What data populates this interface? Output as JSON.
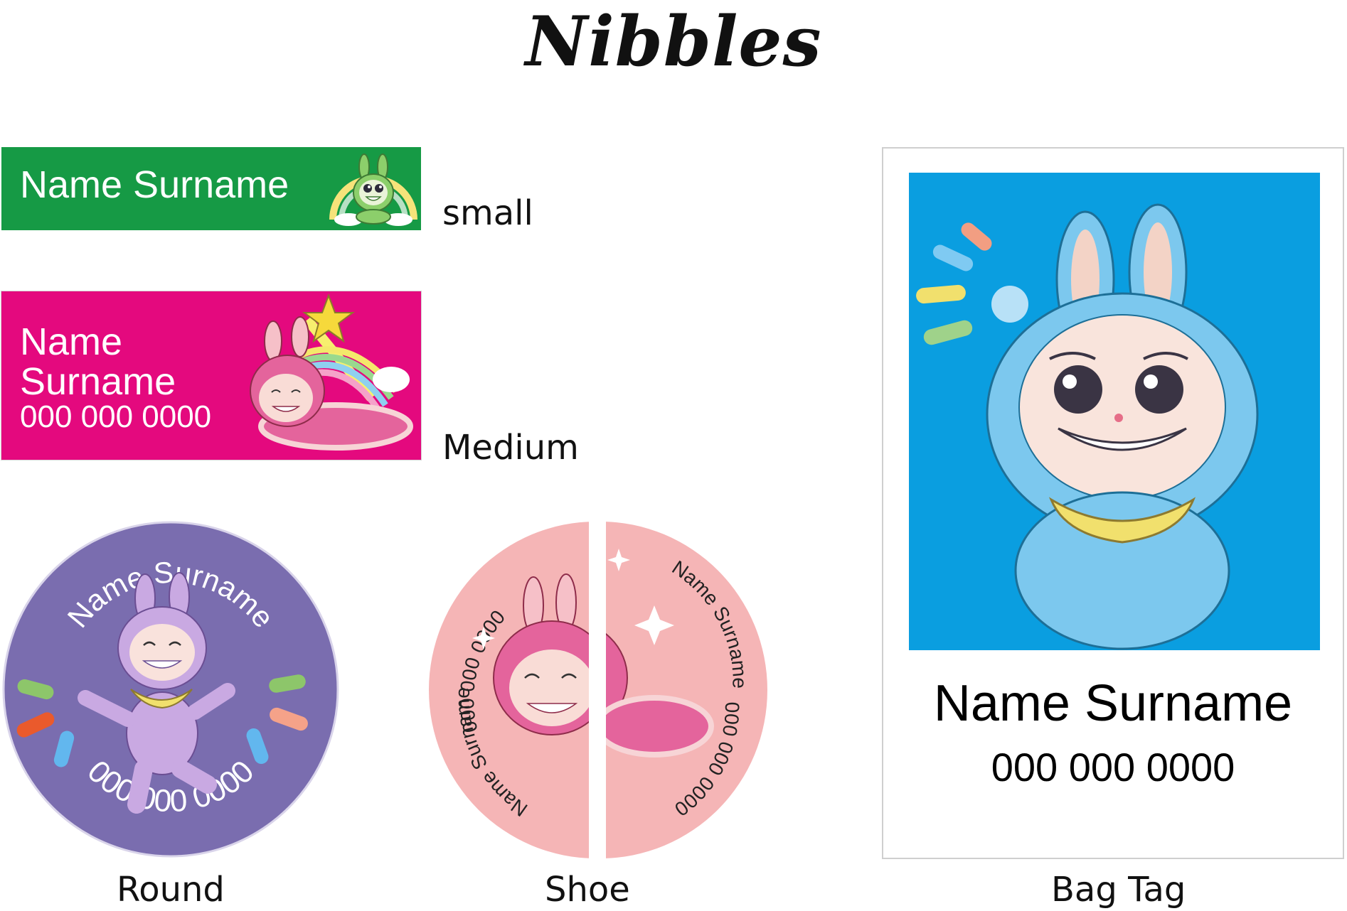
{
  "title": "Nibbles",
  "colors": {
    "small_bg": "#169a45",
    "medium_bg": "#e4097e",
    "round_bg": "#7a6daf",
    "shoe_bg": "#f5b5b6",
    "bag_bg": "#0a9ee0"
  },
  "small": {
    "name": "Name Surname",
    "caption": "small"
  },
  "medium": {
    "first": "Name",
    "last": "Surname",
    "phone": "000 000 0000",
    "caption": "Medium"
  },
  "round": {
    "name": "Name Surname",
    "phone": "000 000 0000",
    "caption": "Round"
  },
  "shoe": {
    "left_phone": "000 000 0000",
    "left_name": "Name Surname",
    "right_name": "Name Surname",
    "right_phone": "000 000 0000",
    "caption": "Shoe"
  },
  "bag_tag": {
    "name": "Name Surname",
    "phone": "000 000 0000",
    "caption": "Bag Tag"
  },
  "icons": [
    "bunny-mascot-icon",
    "star-icon",
    "rainbow-icon",
    "sparkle-icon"
  ]
}
